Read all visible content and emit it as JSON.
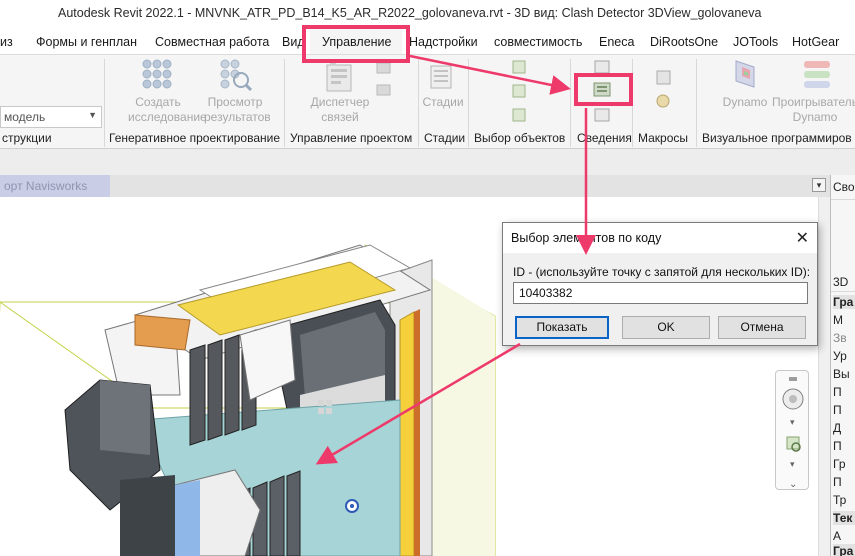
{
  "window": {
    "title": "Autodesk Revit 2022.1 - MNVNK_ATR_PD_B14_K5_AR_R2022_golovaneva.rvt - 3D вид: Clash Detector 3DView_golovaneva"
  },
  "tabs": [
    {
      "label": "из"
    },
    {
      "label": "Формы и генплан"
    },
    {
      "label": "Совместная работа"
    },
    {
      "label": "Вид"
    },
    {
      "label": "Управление"
    },
    {
      "label": "Надстройки"
    },
    {
      "label": "совместимость"
    },
    {
      "label": "Eneca"
    },
    {
      "label": "DiRootsOne"
    },
    {
      "label": "JOTools"
    },
    {
      "label": "HotGear"
    }
  ],
  "active_tab": "Управление",
  "ribbon": {
    "dropdown_value": "модель",
    "buttons": {
      "create_study_1": "Создать",
      "create_study_2": "исследование",
      "view_results_1": "Просмотр",
      "view_results_2": "результатов",
      "links_manager_1": "Диспетчер",
      "links_manager_2": "связей",
      "phases": "Стадии",
      "dynamo": "Dynamo",
      "dynamo_player_1": "Проигрыватель",
      "dynamo_player_2": "Dynamo"
    },
    "panels": {
      "p0": "струкции",
      "p1": "Генеративное проектирование",
      "p2": "Управление проектом",
      "p3": "Стадии",
      "p4": "Выбор объектов",
      "p5": "Сведения",
      "p6": "Макросы",
      "p7": "Визуальное программиров"
    }
  },
  "view_tab": {
    "label": "орт Navisworks"
  },
  "dialog": {
    "title": "Выбор элементов по коду",
    "label": "ID - (используйте точку с запятой для нескольких ID):",
    "value": "10403382",
    "show_button": "Показать",
    "ok_button": "OK",
    "cancel_button": "Отмена"
  },
  "right_panel": {
    "header": "Сво",
    "items": [
      "3D",
      "Гра",
      "М",
      "Зв",
      "Ур",
      "Вы",
      "П",
      "П",
      "Д",
      "П",
      "Гр",
      "П",
      "Тр",
      "Тек",
      "А",
      "Гра"
    ]
  },
  "colors": {
    "highlight": "#ee3a6b",
    "dialog_default": "#0a64c8"
  }
}
